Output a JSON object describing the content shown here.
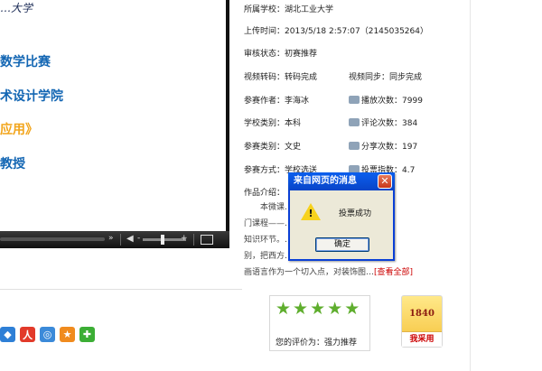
{
  "video": {
    "logo_text": "…大学",
    "slide_lines": [
      "数学比赛",
      "术设计学院",
      "应用》",
      "教授"
    ],
    "controls": {
      "next_glyph": "»",
      "volume_glyph": "◀",
      "minus": "-",
      "plus": "+"
    }
  },
  "info": {
    "school": {
      "label": "所属学校：",
      "value": "湖北工业大学"
    },
    "upload": {
      "label": "上传时间：",
      "value": "2013/5/18 2:57:07（2145035264）"
    },
    "review": {
      "label": "审核状态：",
      "value": "初赛推荐"
    },
    "transcode": {
      "label": "视频转码：",
      "value": "转码完成"
    },
    "sync": {
      "label": "视频同步：",
      "value": "同步完成"
    },
    "author": {
      "label": "参赛作者：",
      "value": "李海冰"
    },
    "plays": {
      "label": "播放次数：",
      "value": "7999"
    },
    "school_type": {
      "label": "学校类别：",
      "value": "本科"
    },
    "comments": {
      "label": "评论次数：",
      "value": "384"
    },
    "category": {
      "label": "参赛类别：",
      "value": "文史"
    },
    "shares": {
      "label": "分享次数：",
      "value": "197"
    },
    "method": {
      "label": "参赛方式：",
      "value": "学校选送"
    },
    "votes": {
      "label": "投票指数：",
      "value": "4.7"
    },
    "intro_label": "作品介绍：",
    "intro_lines": [
      "本微课……业开设的一",
      "门课程——……一个重要的",
      "知识环节。……，选题较特",
      "别，把西方……的装饰性绘"
    ],
    "intro_last_line": "画语言作为一个切入点，对装饰图…",
    "view_all": "[查看全部]"
  },
  "rating": {
    "label": "您的评价为：",
    "value": "强力推荐",
    "stars": 5
  },
  "adopt": {
    "count": "1840",
    "button": "我采用"
  },
  "dialog": {
    "title": "来自网页的消息",
    "message": "投票成功",
    "ok": "确定",
    "close": "✕"
  },
  "colors": {
    "accent_blue": "#0a5fee",
    "star_green": "#5fae2e",
    "link_red": "#cc0000"
  }
}
